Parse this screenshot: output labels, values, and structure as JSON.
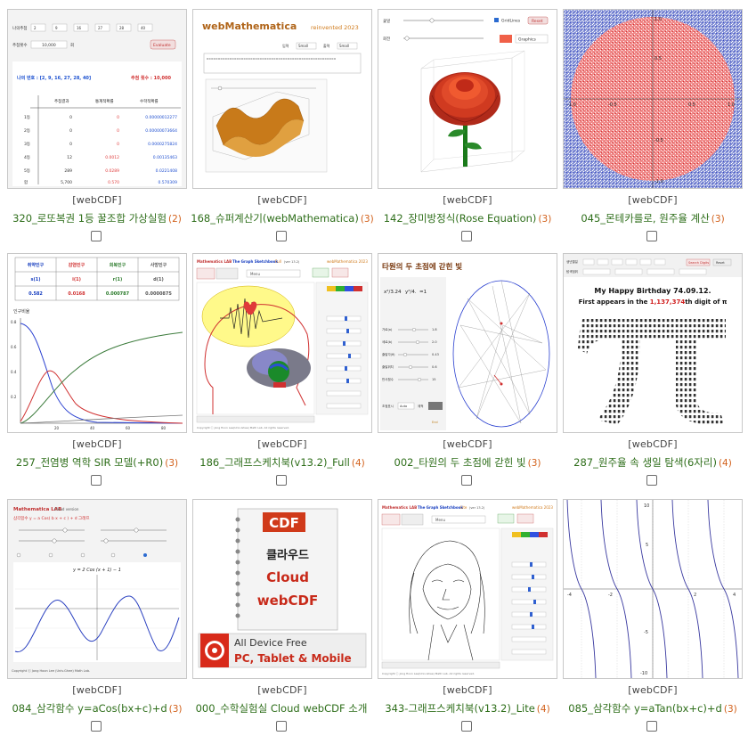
{
  "colors": {
    "title": "#2e6e1a",
    "count": "#d2601a",
    "category": "#444444"
  },
  "items": [
    {
      "category": "[webCDF]",
      "title": "320_로또복권 1등 꿀조합 가상실험",
      "count": "(2)",
      "thumb": {
        "headers": [
          "추첨결과",
          "통계적확률",
          "수학적확률"
        ],
        "labels": [
          "1등",
          "2등",
          "3등",
          "4등",
          "5등",
          "합"
        ],
        "result": "나의 번호 : [2, 9, 16, 27, 28, 40]",
        "draws": "추첨 횟수 : 10,000",
        "spin_labels": [
          "나의추첨",
          "추첨횟수"
        ],
        "button": "Evaluate",
        "input": "10,000",
        "unit": "회",
        "numbers": [
          "2",
          "9",
          "16",
          "27",
          "28",
          "40"
        ],
        "col1": [
          "0",
          "0",
          "0",
          "12",
          "289",
          "5,700"
        ],
        "col2": [
          "0",
          "0",
          "0",
          "0.0012",
          "0.0289",
          "0.570"
        ],
        "col3": [
          "0.00000012277",
          "0.00000073664",
          "0.0000275824",
          "0.00135463",
          "0.0221408",
          "0.570309"
        ]
      }
    },
    {
      "category": "[webCDF]",
      "title": "168_슈퍼계산기(webMathematica)",
      "count": "(3)",
      "thumb": {
        "brand": "webMathematica",
        "tagline": "reinvented 2023",
        "label1": "입력",
        "label2": "출력",
        "opt1": "Small",
        "opt2": "Small"
      }
    },
    {
      "category": "[webCDF]",
      "title": "142_장미방정식(Rose Equation)",
      "count": "(3)",
      "thumb": {
        "slider1": "꽃잎",
        "slider2": "회전",
        "checkbox": "GridLines",
        "reset": "Reset",
        "select": "Graphics"
      }
    },
    {
      "category": "[webCDF]",
      "title": "045_몬테카를로, 원주율 계산",
      "count": "(3)",
      "thumb": {
        "ticks_x": [
          "-1.0",
          "-0.5",
          "0.5",
          "1.0"
        ],
        "ticks_y": [
          "1.0",
          "0.5",
          "-0.5",
          "-1.0"
        ]
      }
    },
    {
      "category": "[webCDF]",
      "title": "257_전염병 역학 SIR 모델(+R0)",
      "count": "(3)",
      "thumb": {
        "headers": [
          "취약인구",
          "감염인구",
          "회복인구",
          "사망인구"
        ],
        "symbols": [
          "s(1)",
          "i(1)",
          "r(1)",
          "d(1)"
        ],
        "values": [
          "0.582",
          "0.0168",
          "0.000787",
          "0.0000875"
        ],
        "ylabel": "인구비율",
        "yticks": [
          "0.8",
          "0.6",
          "0.4",
          "0.2"
        ],
        "xticks": [
          "20",
          "40",
          "60",
          "80"
        ]
      }
    },
    {
      "category": "[webCDF]",
      "title": "186_그래프스케치북(v13.2)_Full",
      "count": "(4)",
      "thumb": {
        "lab": "Mathematics LAB",
        "name": "The Graph Sketchbook",
        "edition": "Full",
        "ver": "(ver 13.2)",
        "brand": "webMathematica 2023",
        "menu": "Menu",
        "footer": "Copyright ⓒ Jong Hoon Lee(Univ.Ghee) Math Lab. All rights reserved."
      }
    },
    {
      "category": "[webCDF]",
      "title": "002_타원의 두 초점에 갇힌 빛",
      "count": "(3)",
      "thumb": {
        "heading": "타원의 두 초점에 갇힌 빛",
        "eq1": "x²/3.24",
        "eq2": "y²/4.",
        "eq_end": "=1",
        "slider_labels": [
          "가로(a)",
          "세로(b)",
          "출발각(θ)",
          "출발위치",
          "반사횟수"
        ],
        "slider_values": [
          "1.8",
          "2.0",
          "0.43",
          "0.6",
          "15"
        ],
        "bottom": "초점표시",
        "mode": "Auto",
        "trace": "궤적",
        "end": "End"
      }
    },
    {
      "category": "[webCDF]",
      "title": "287_원주율 속 생일 탐색(6자리)",
      "count": "(4)",
      "thumb": {
        "line1": "My Happy Birthday 74.09.12.",
        "line2_pre": "First appears in the ",
        "line2_num": "1,137,374",
        "line2_post": "th digit of π",
        "ctrl1": "생년월일",
        "ctrl2": "탐색범위",
        "button": "Search Digits",
        "reset": "Reset"
      }
    },
    {
      "category": "[webCDF]",
      "title": "084_삼각함수 y=aCos(bx+c)+d",
      "count": "(3)",
      "thumb": {
        "lab": "Mathematica LAB",
        "version": "Cloud version",
        "subtitle": "삼각함수 y = a Cos( b x + c ) + d 그래프",
        "formula": "y = 2 Cos (x + 1) − 1",
        "footer": "Copyright ⓒ Jong Hoon Lee (Univ.Ghee) Math Lab."
      }
    },
    {
      "category": "[webCDF]",
      "title": "000_수학실험실 Cloud webCDF 소개",
      "count": "",
      "thumb": {
        "cdf": "CDF",
        "line1": "클라우드",
        "line2": "Cloud",
        "line3": "webCDF",
        "free": "All Device Free",
        "devices": "PC, Tablet & Mobile"
      }
    },
    {
      "category": "[webCDF]",
      "title": "343-그래프스케치북(v13.2)_Lite",
      "count": "(4)",
      "thumb": {
        "lab": "Mathematics LAB",
        "name": "The Graph Sketchbook",
        "edition": "Lite",
        "ver": "(ver 13.2)",
        "brand": "webMathematica 2023",
        "menu": "Menu",
        "footer": "Copyright ⓒ Jong Hoon Lee(Univ.Ghee) Math Lab. All rights reserved."
      }
    },
    {
      "category": "[webCDF]",
      "title": "085_삼각함수 y=aTan(bx+c)+d",
      "count": "(3)",
      "thumb": {
        "ticks_x": [
          "-4",
          "-2",
          "2",
          "4"
        ],
        "ticks_y": [
          "10",
          "5",
          "-5",
          "-10"
        ]
      }
    }
  ]
}
